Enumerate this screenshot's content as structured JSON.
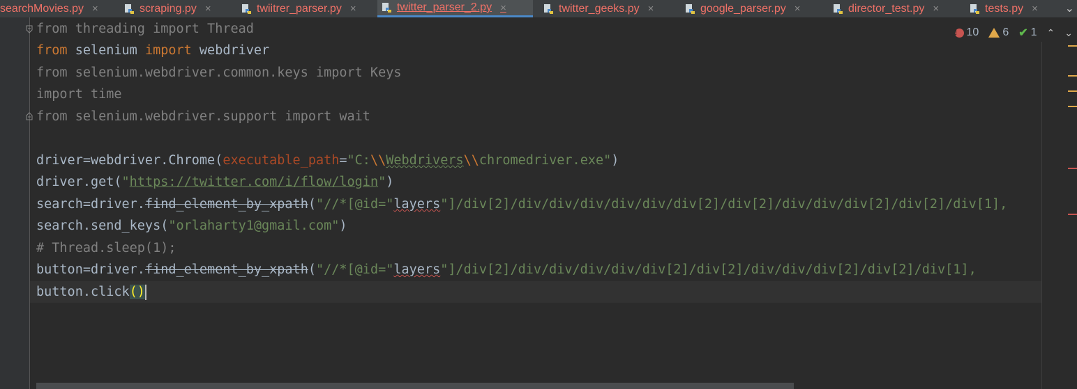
{
  "tabs": [
    {
      "label": "searchMovies.py",
      "active": false
    },
    {
      "label": "scraping.py",
      "active": false
    },
    {
      "label": "twiitrer_parser.py",
      "active": false
    },
    {
      "label": "twitter_parser_2.py",
      "active": true
    },
    {
      "label": "twitter_geeks.py",
      "active": false
    },
    {
      "label": "google_parser.py",
      "active": false
    },
    {
      "label": "director_test.py",
      "active": false
    },
    {
      "label": "tests.py",
      "active": false
    }
  ],
  "tab_close_symbol": "×",
  "tab_chevron_symbol": "⌄",
  "inspections": {
    "errors": "10",
    "warnings": "6",
    "ok": "1"
  },
  "code": {
    "line1_from": "from",
    "line1_module": " threading ",
    "line1_import": "import",
    "line1_name": " Thread",
    "line2_from": "from",
    "line2_module": " selenium ",
    "line2_import": "import",
    "line2_name": " webdriver",
    "line3": "from selenium.webdriver.common.keys import Keys",
    "line4": "import time",
    "line5": "from selenium.webdriver.support import wait",
    "line7_a": "driver=webdriver.Chrome(",
    "line7_param": "executable_path",
    "line7_eq": "=",
    "line7_s1": "\"C:",
    "line7_e1": "\\\\",
    "line7_s2": "Webdrivers",
    "line7_e2": "\\\\",
    "line7_s3": "chromedriver.exe\"",
    "line7_close": ")",
    "line8_a": "driver.get(",
    "line8_q1": "\"",
    "line8_url": "https://twitter.com/i/flow/login",
    "line8_q2": "\"",
    "line8_close": ")",
    "line9_a": "search=driver.",
    "line9_fn": "find_element_by_xpath",
    "line9_b": "(",
    "line9_s1": "\"//*[@id=\"",
    "line9_id": "layers",
    "line9_s2": "\"]/div[2]/div/div/div/div/div/div[2]/div[2]/div/div/div[2]/div[2]/div[1],",
    "line10_a": "search.send_keys(",
    "line10_s": "\"orlaharty1@gmail.com\"",
    "line10_close": ")",
    "line11": "# Thread.sleep(1);",
    "line12_a": "button=driver.",
    "line12_fn": "find_element_by_xpath",
    "line12_b": "(",
    "line12_s1": "\"//*[@id=\"",
    "line12_id": "layers",
    "line12_s2": "\"]/div[2]/div/div/div/div/div[2]/div[2]/div/div/div[2]/div[2]/div[1],",
    "line13_a": "button.click",
    "line13_paren": "()"
  }
}
